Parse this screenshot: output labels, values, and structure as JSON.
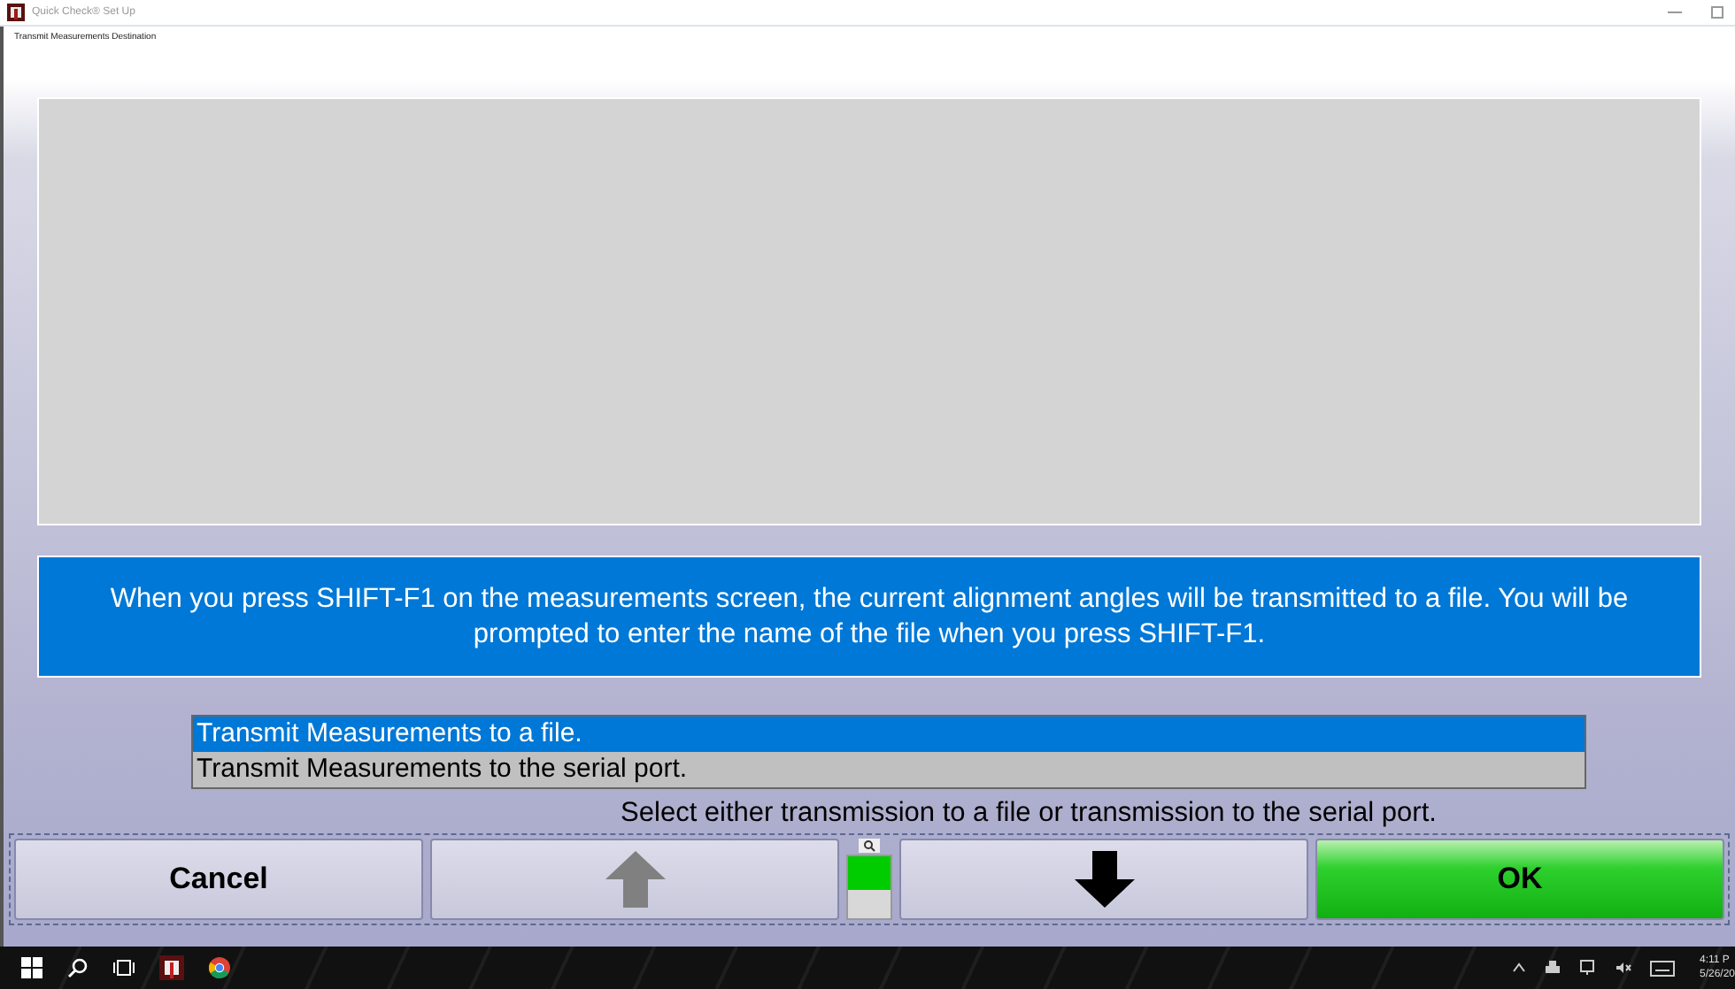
{
  "window": {
    "title": "Quick Check® Set Up"
  },
  "screen_title": "Transmit Measurements Destination",
  "message": "When you press SHIFT-F1 on the measurements screen, the current alignment angles will be transmitted to a file.  You will be prompted to enter the name of the file when you press SHIFT-F1.",
  "options": [
    {
      "label": "Transmit Measurements to a file.",
      "selected": true
    },
    {
      "label": "Transmit Measurements to the serial port.",
      "selected": false
    }
  ],
  "hint": "Select either transmission to a file or transmission to the serial port.",
  "buttons": [
    {
      "kind": "text",
      "label": "Cancel"
    },
    {
      "kind": "up"
    },
    {
      "kind": "indicator"
    },
    {
      "kind": "down"
    },
    {
      "kind": "ok",
      "label": "OK"
    }
  ],
  "taskbar": {
    "time": "4:11 P",
    "date": "5/26/20"
  }
}
